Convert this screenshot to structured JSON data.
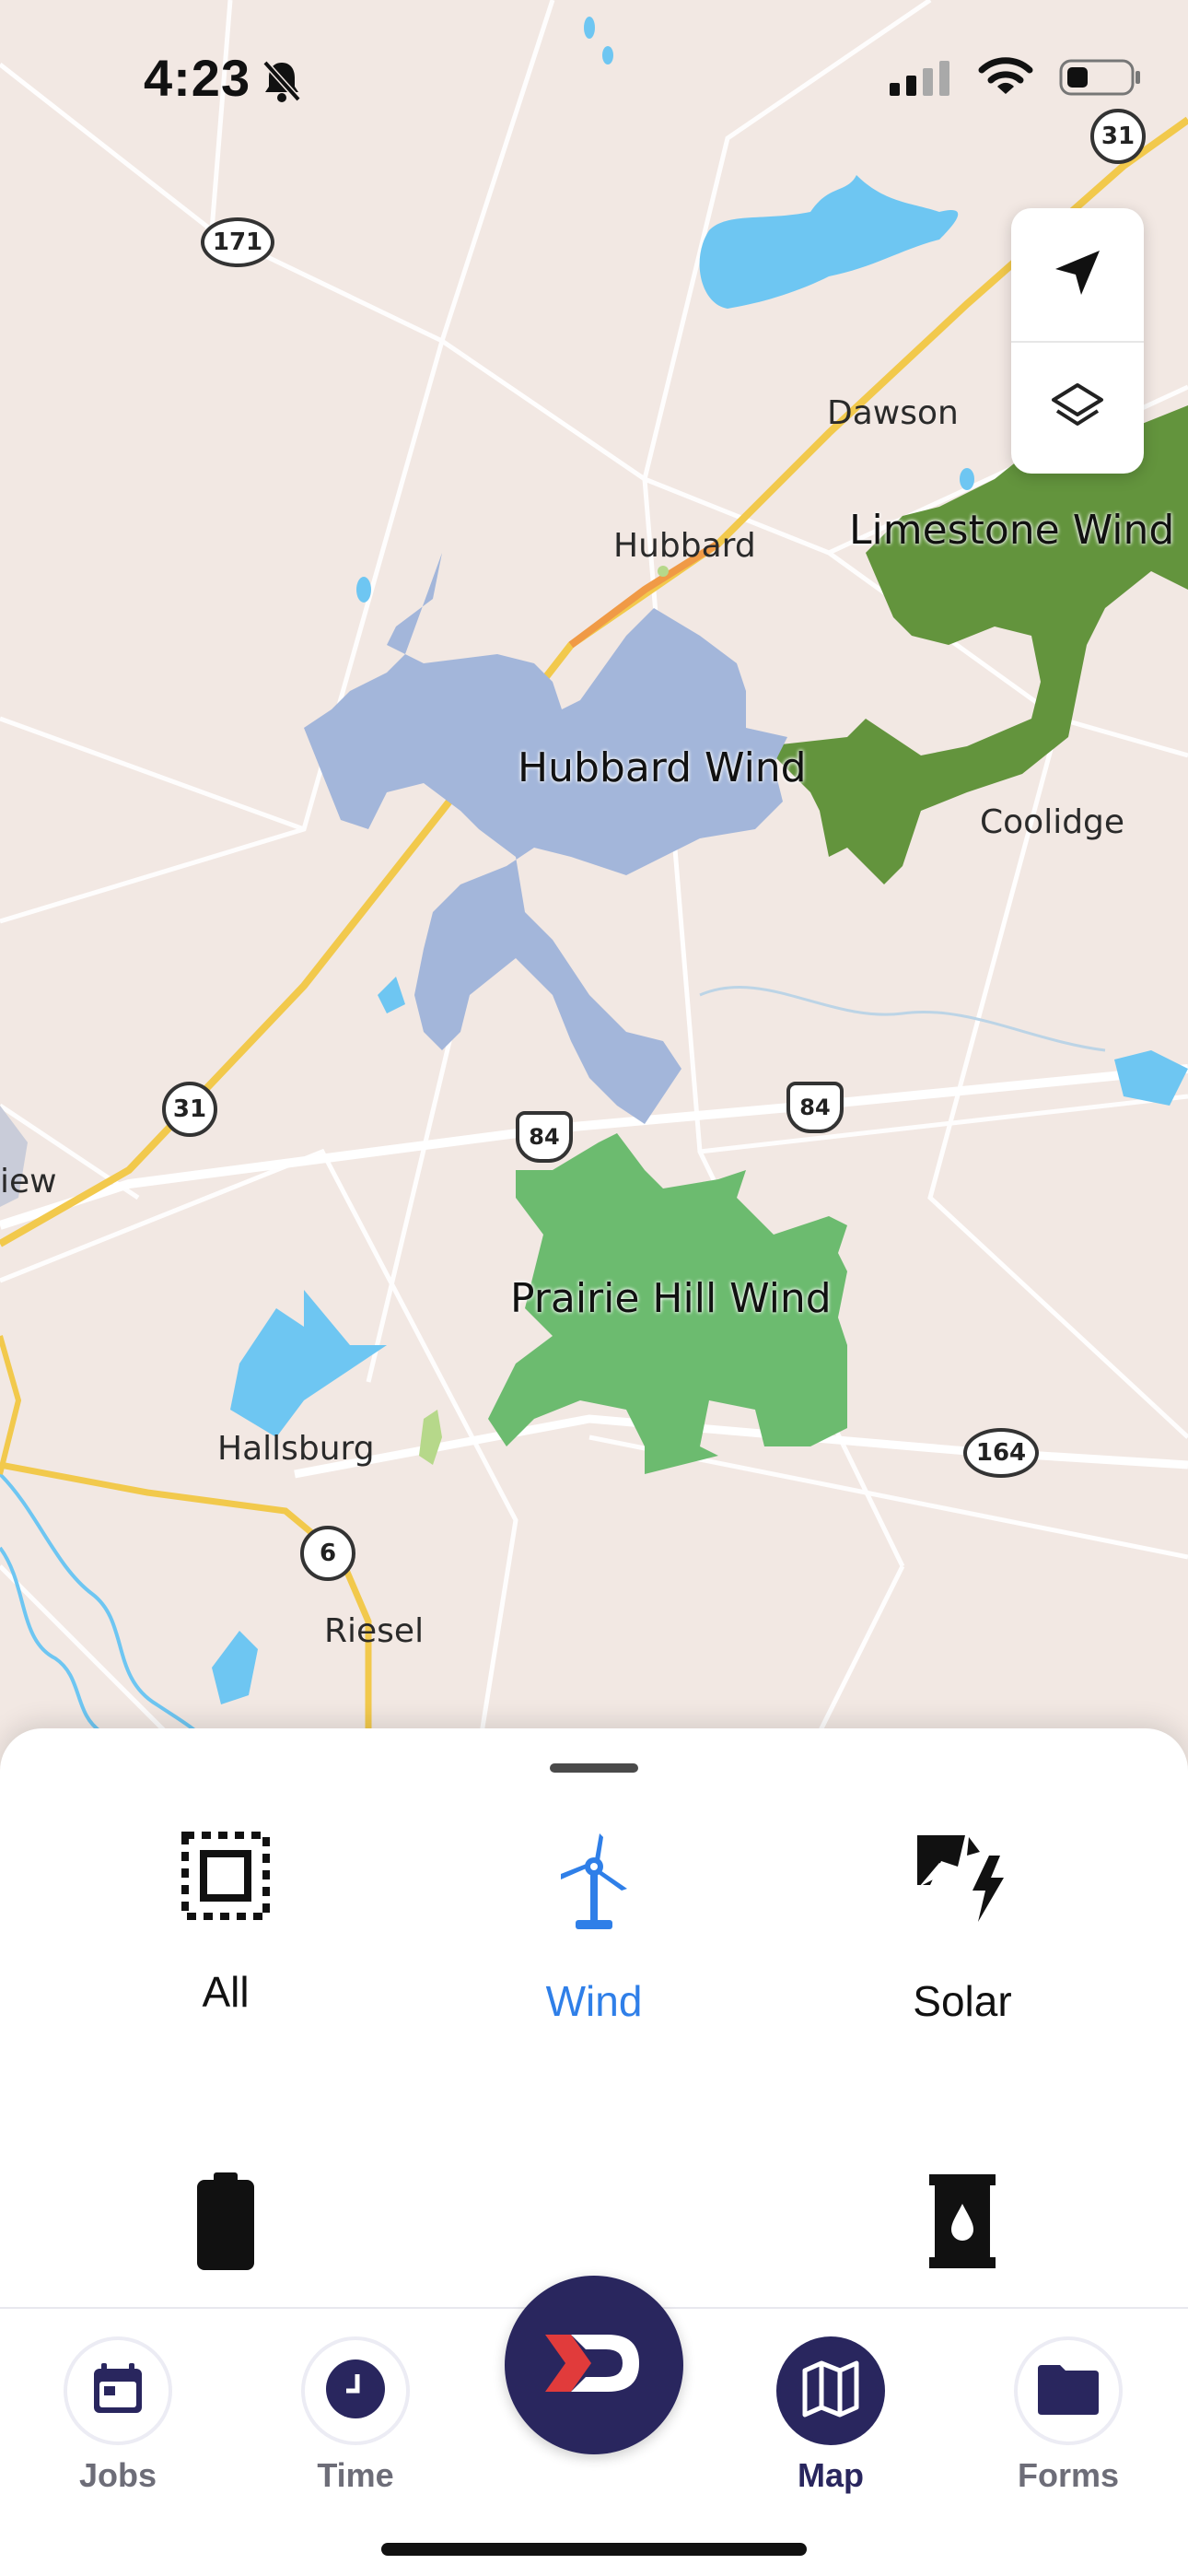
{
  "status_bar": {
    "time": "4:23"
  },
  "map": {
    "places": {
      "dawson": "Dawson",
      "hubbard": "Hubbard",
      "coolidge": "Coolidge",
      "hallsburg": "Hallsburg",
      "riesel": "Riesel",
      "view_partial": "iew"
    },
    "farms": {
      "limestone": "Limestone Wind",
      "hubbard": "Hubbard Wind",
      "prairie_hill": "Prairie Hill Wind"
    },
    "shields": {
      "r31_top": "31",
      "r171": "171",
      "r31_left": "31",
      "us84_left": "84",
      "us84_right": "84",
      "r164": "164",
      "r6": "6"
    },
    "colors": {
      "land": "#f2e8e3",
      "water": "#6ec6f2",
      "hubbard_farm": "#a3b6da",
      "limestone_farm": "#63943d",
      "prairie_farm": "#6cbb6f",
      "highway": "#f2c94c"
    }
  },
  "categories": {
    "all": "All",
    "wind": "Wind",
    "solar": "Solar",
    "active": "Wind",
    "active_color": "#2f7fe8"
  },
  "tabs": {
    "jobs": "Jobs",
    "time": "Time",
    "map": "Map",
    "forms": "Forms",
    "active": "Map",
    "brand_color": "#29265e"
  }
}
